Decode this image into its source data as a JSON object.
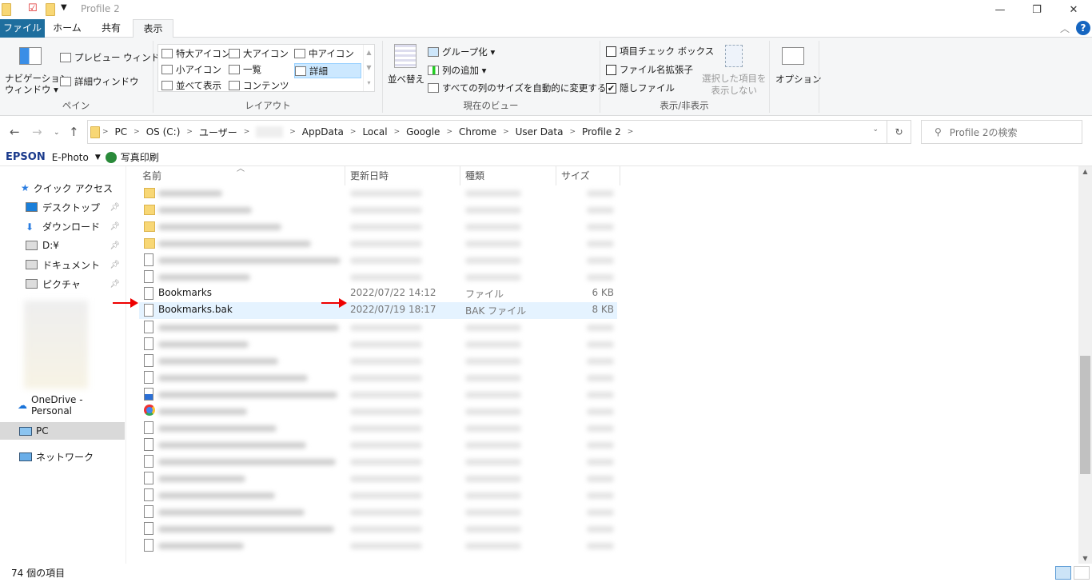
{
  "window": {
    "title": "Profile 2",
    "minimize": "—",
    "restore": "❐",
    "close": "✕"
  },
  "tabs": [
    "ファイル",
    "ホーム",
    "共有",
    "表示"
  ],
  "ribbon": {
    "pane": {
      "nav": "ナビゲーション\nウィンドウ ▾",
      "preview": "プレビュー ウィンドウ",
      "details": "詳細ウィンドウ",
      "label": "ペイン"
    },
    "layout": {
      "items": [
        "特大アイコン",
        "大アイコン",
        "中アイコン",
        "小アイコン",
        "一覧",
        "詳細",
        "並べて表示",
        "コンテンツ"
      ],
      "selected": "詳細",
      "label": "レイアウト"
    },
    "view": {
      "sort": "並べ替え",
      "group": "グループ化 ▾",
      "add_col": "列の追加 ▾",
      "autosize": "すべての列のサイズを自動的に変更する",
      "label": "現在のビュー"
    },
    "showhide": {
      "item_checkbox": "項目チェック ボックス",
      "item_checkbox_checked": false,
      "ext": "ファイル名拡張子",
      "ext_checked": false,
      "hidden": "隠しファイル",
      "hidden_checked": true,
      "hide_selected": "選択した項目を\n表示しない",
      "label": "表示/非表示"
    },
    "options": "オプション"
  },
  "address": {
    "crumbs": [
      "PC",
      "OS (C:)",
      "ユーザー",
      "",
      "AppData",
      "Local",
      "Google",
      "Chrome",
      "User Data",
      "Profile 2"
    ],
    "search_placeholder": "Profile 2の検索"
  },
  "toolbar2": {
    "brand": "EPSON",
    "app": "E-Photo",
    "print": "写真印刷"
  },
  "nav": {
    "quick_access": "クイック アクセス",
    "items": [
      "デスクトップ",
      "ダウンロード",
      "D:¥",
      "ドキュメント",
      "ピクチャ"
    ],
    "onedrive": "OneDrive - Personal",
    "pc": "PC",
    "network": "ネットワーク"
  },
  "columns": {
    "name": "名前",
    "date": "更新日時",
    "type": "種類",
    "size": "サイズ"
  },
  "files": [
    {
      "icon": "folder"
    },
    {
      "icon": "folder"
    },
    {
      "icon": "folder"
    },
    {
      "icon": "folder"
    },
    {
      "icon": "file"
    },
    {
      "icon": "file"
    },
    {
      "icon": "file",
      "name": "Bookmarks",
      "date": "2022/07/22 14:12",
      "type": "ファイル",
      "size": "6 KB"
    },
    {
      "icon": "file",
      "name": "Bookmarks.bak",
      "date": "2022/07/19 18:17",
      "type": "BAK ファイル",
      "size": "8 KB",
      "selected": true
    },
    {
      "icon": "file"
    },
    {
      "icon": "file"
    },
    {
      "icon": "file"
    },
    {
      "icon": "file"
    },
    {
      "icon": "doc"
    },
    {
      "icon": "chrome"
    },
    {
      "icon": "gear"
    },
    {
      "icon": "file"
    },
    {
      "icon": "file"
    },
    {
      "icon": "file"
    },
    {
      "icon": "file"
    },
    {
      "icon": "file"
    },
    {
      "icon": "file"
    },
    {
      "icon": "file"
    }
  ],
  "status": {
    "count": "74 個の項目"
  },
  "colors": {
    "file_tab": "#1e6e9e",
    "selection": "#e5f3ff",
    "arrow": "#e00000"
  }
}
